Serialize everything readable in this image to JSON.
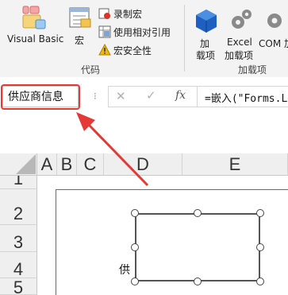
{
  "ribbon": {
    "visual_basic": "Visual Basic",
    "macros": "宏",
    "record_macro": "录制宏",
    "relative_ref": "使用相对引用",
    "macro_security": "宏安全性",
    "code_group": "代码",
    "addins_line1": "加",
    "addins_line2": "载项",
    "excel_addins_line1": "Excel",
    "excel_addins_line2": "加载项",
    "com_addins": "COM 加",
    "addins_group": "加载项"
  },
  "formula_bar": {
    "name_box": "供应商信息",
    "cancel": "✕",
    "enter": "✓",
    "fx": "fx",
    "formula": "=嵌入(\"Forms.Lis"
  },
  "sheet": {
    "columns": [
      "A",
      "B",
      "C",
      "D",
      "E"
    ],
    "rows": [
      "1",
      "2",
      "3",
      "4",
      "5"
    ],
    "cell_text": "供"
  },
  "colors": {
    "highlight": "#e53935",
    "ribbon_bg": "#f3f3f3",
    "header_bg": "#efefef"
  }
}
